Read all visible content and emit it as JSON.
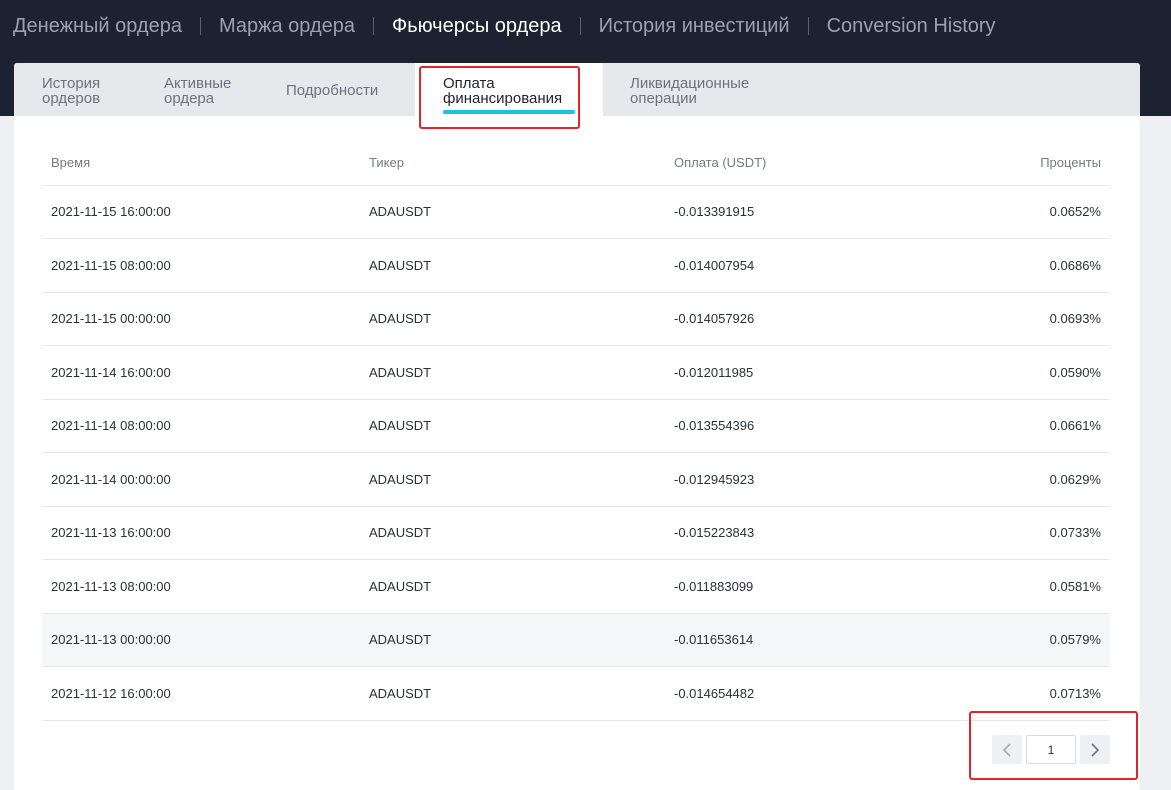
{
  "top_nav": [
    {
      "label": "Денежный ордера",
      "active": false
    },
    {
      "label": "Маржа ордера",
      "active": false
    },
    {
      "label": "Фьючерсы ордера",
      "active": true
    },
    {
      "label": "История инвестиций",
      "active": false
    },
    {
      "label": "Conversion History",
      "active": false
    }
  ],
  "sub_tabs": [
    {
      "label": "История\nордеров",
      "active": false
    },
    {
      "label": "Активные\nордера",
      "active": false
    },
    {
      "label": "Подробности",
      "active": false
    },
    {
      "label": "Оплата\nфинансирования",
      "active": true
    },
    {
      "label": "Ликвидационные\nоперации",
      "active": false
    }
  ],
  "table": {
    "headers": [
      "Время",
      "Тикер",
      "Оплата (USDT)",
      "Проценты"
    ],
    "rows": [
      [
        "2021-11-15 16:00:00",
        "ADAUSDT",
        "-0.013391915",
        "0.0652%"
      ],
      [
        "2021-11-15 08:00:00",
        "ADAUSDT",
        "-0.014007954",
        "0.0686%"
      ],
      [
        "2021-11-15 00:00:00",
        "ADAUSDT",
        "-0.014057926",
        "0.0693%"
      ],
      [
        "2021-11-14 16:00:00",
        "ADAUSDT",
        "-0.012011985",
        "0.0590%"
      ],
      [
        "2021-11-14 08:00:00",
        "ADAUSDT",
        "-0.013554396",
        "0.0661%"
      ],
      [
        "2021-11-14 00:00:00",
        "ADAUSDT",
        "-0.012945923",
        "0.0629%"
      ],
      [
        "2021-11-13 16:00:00",
        "ADAUSDT",
        "-0.015223843",
        "0.0733%"
      ],
      [
        "2021-11-13 08:00:00",
        "ADAUSDT",
        "-0.011883099",
        "0.0581%"
      ],
      [
        "2021-11-13 00:00:00",
        "ADAUSDT",
        "-0.011653614",
        "0.0579%"
      ],
      [
        "2021-11-12 16:00:00",
        "ADAUSDT",
        "-0.014654482",
        "0.0713%"
      ]
    ]
  },
  "pagination": {
    "current_page": "1",
    "prev_icon": "chevron-left-icon",
    "next_icon": "chevron-right-icon"
  },
  "colors": {
    "header_bg": "#1d2230",
    "active_underline": "#1bc2e0",
    "highlight_border": "#e0262b"
  }
}
